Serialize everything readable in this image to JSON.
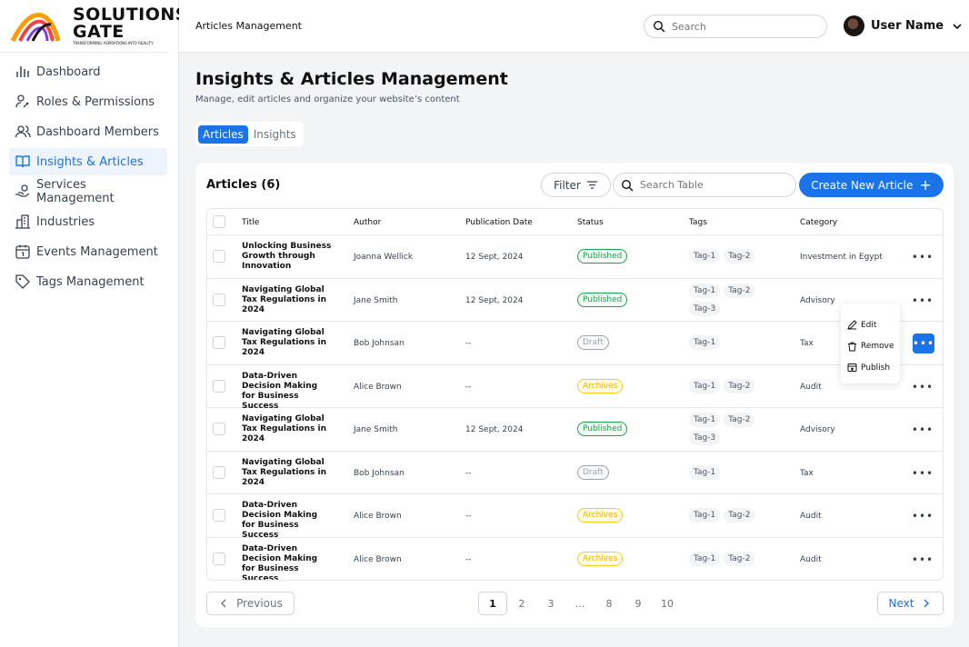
{
  "brand": {
    "name": "SOLUTIONS GATE",
    "tagline": "TRANSFORMING ASPIRATIONS INTO REALITY."
  },
  "sidebar": {
    "items": [
      {
        "label": "Dashboard",
        "icon": "bar-chart-icon"
      },
      {
        "label": "Roles & Permissions",
        "icon": "user-key-icon"
      },
      {
        "label": "Dashboard Members",
        "icon": "users-icon"
      },
      {
        "label": "Insights & Articles",
        "icon": "book-open-icon",
        "active": true
      },
      {
        "label": "Services Management",
        "icon": "hand-coins-icon"
      },
      {
        "label": "Industries",
        "icon": "building-icon"
      },
      {
        "label": "Events Management",
        "icon": "calendar-icon"
      },
      {
        "label": "Tags Management",
        "icon": "tag-icon"
      }
    ]
  },
  "topbar": {
    "breadcrumb": "Articles Management",
    "search_placeholder": "Search",
    "user_name": "User Name"
  },
  "page": {
    "title": "Insights & Articles Management",
    "subtitle": "Manage, edit articles and organize your website’s content",
    "tabs": [
      {
        "label": "Articles",
        "active": true
      },
      {
        "label": "Insights"
      }
    ]
  },
  "table_card": {
    "title": "Articles (6)",
    "filter_label": "Filter",
    "search_placeholder": "Search Table",
    "create_label": "Create New Article",
    "columns": [
      "Title",
      "Author",
      "Publication Date",
      "Status",
      "Tags",
      "Category"
    ],
    "rows": [
      {
        "title": "Unlocking Business Growth through Innovation",
        "author": "Joanna Wellick",
        "date": "12 Sept, 2024",
        "status": "Published",
        "tags": [
          "Tag-1",
          "Tag-2"
        ],
        "category": "Investment in Egypt"
      },
      {
        "title": "Navigating Global Tax Regulations in 2024",
        "author": "Jane Smith",
        "date": "12 Sept, 2024",
        "status": "Published",
        "tags": [
          "Tag-1",
          "Tag-2",
          "Tag-3"
        ],
        "category": "Advisory"
      },
      {
        "title": "Navigating Global Tax Regulations in 2024",
        "author": "Bob Johnsan",
        "date": "--",
        "status": "Draft",
        "tags": [
          "Tag-1"
        ],
        "category": "Tax",
        "menu_open": true
      },
      {
        "title": "Data-Driven Decision Making for Business Success",
        "author": "Alice Brown",
        "date": "--",
        "status": "Archives",
        "tags": [
          "Tag-1",
          "Tag-2"
        ],
        "category": "Audit"
      },
      {
        "title": "Navigating Global Tax Regulations in 2024",
        "author": "Jane Smith",
        "date": "12 Sept, 2024",
        "status": "Published",
        "tags": [
          "Tag-1",
          "Tag-2",
          "Tag-3"
        ],
        "category": "Advisory"
      },
      {
        "title": "Navigating Global Tax Regulations in 2024",
        "author": "Bob Johnsan",
        "date": "--",
        "status": "Draft",
        "tags": [
          "Tag-1"
        ],
        "category": "Tax"
      },
      {
        "title": "Data-Driven Decision Making for Business Success",
        "author": "Alice Brown",
        "date": "--",
        "status": "Archives",
        "tags": [
          "Tag-1",
          "Tag-2"
        ],
        "category": "Audit"
      },
      {
        "title": "Data-Driven Decision Making for Business Success",
        "author": "Alice Brown",
        "date": "--",
        "status": "Archives",
        "tags": [
          "Tag-1",
          "Tag-2"
        ],
        "category": "Audit"
      }
    ],
    "row_menu": [
      {
        "label": "Edit",
        "icon": "pencil-icon"
      },
      {
        "label": "Remove",
        "icon": "trash-icon"
      },
      {
        "label": "Publish",
        "icon": "publish-icon"
      }
    ]
  },
  "pagination": {
    "prev_label": "Previous",
    "next_label": "Next",
    "pages": [
      "1",
      "2",
      "3",
      "...",
      "8",
      "9",
      "10"
    ],
    "current": "1"
  },
  "colors": {
    "accent": "#1a73e8",
    "published": "#16a34a",
    "draft": "#9ca3af",
    "archives": "#eab308"
  }
}
